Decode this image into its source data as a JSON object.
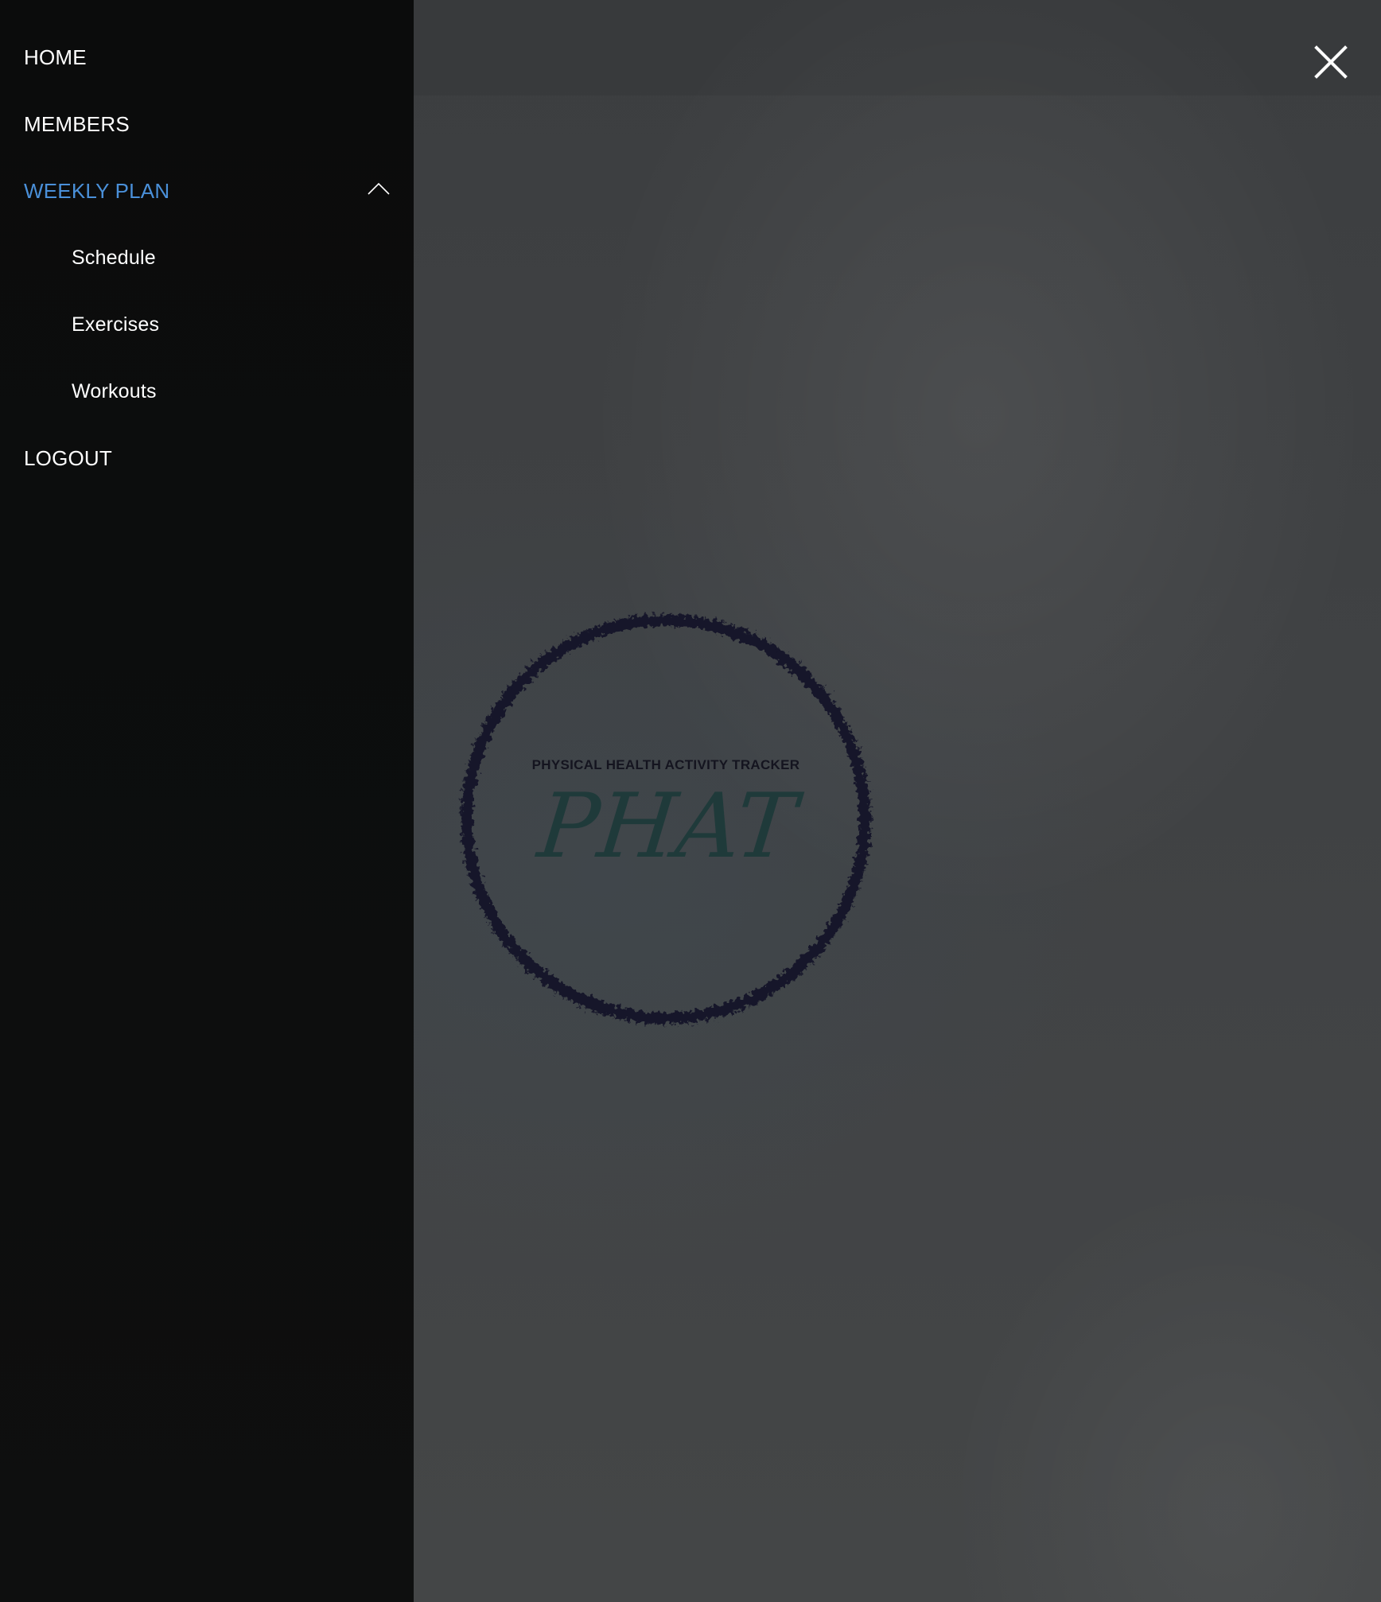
{
  "window": {
    "close_icon": "close-icon"
  },
  "logo": {
    "tagline": "PHYSICAL HEALTH ACTIVITY TRACKER",
    "wordmark": "PHAT",
    "ring_color": "#15152a",
    "wordmark_color": "#1f3a3a"
  },
  "sidebar": {
    "items": [
      {
        "label": "HOME"
      },
      {
        "label": "MEMBERS"
      },
      {
        "label": "WEEKLY PLAN",
        "expanded": true,
        "chevron_icon": "chevron-up-icon"
      },
      {
        "label": "LOGOUT"
      }
    ],
    "weekly_plan_children": [
      {
        "label": "Schedule"
      },
      {
        "label": "Exercises"
      },
      {
        "label": "Workouts"
      }
    ]
  },
  "colors": {
    "accent": "#4a90d9",
    "drawer_bg": "#0c0d0d",
    "text": "#ffffff"
  }
}
